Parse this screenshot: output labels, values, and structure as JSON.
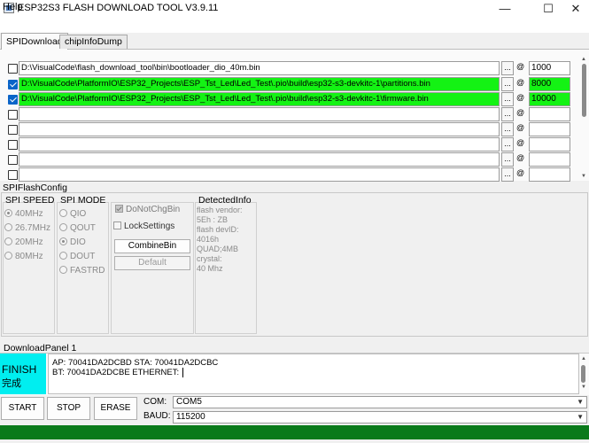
{
  "window": {
    "title": "ESP32S3 FLASH DOWNLOAD TOOL V3.9.11",
    "minimize": "—",
    "maximize": "☐",
    "close": "✕"
  },
  "menu": {
    "help": "Help"
  },
  "tabs": [
    {
      "label": "SPIDownload",
      "active": true
    },
    {
      "label": "chipInfoDump",
      "active": false
    }
  ],
  "files": [
    {
      "checked": false,
      "path": "D:\\VisualCode\\flash_download_tool\\bin\\bootloader_dio_40m.bin",
      "address": "1000",
      "highlight": false
    },
    {
      "checked": true,
      "path": "D:\\VisualCode\\PlatformIO\\ESP32_Projects\\ESP_Tst_Led\\Led_Test\\.pio\\build\\esp32-s3-devkitc-1\\partitions.bin",
      "address": "8000",
      "highlight": true
    },
    {
      "checked": true,
      "path": "D:\\VisualCode\\PlatformIO\\ESP32_Projects\\ESP_Tst_Led\\Led_Test\\.pio\\build\\esp32-s3-devkitc-1\\firmware.bin",
      "address": "10000",
      "highlight": true
    },
    {
      "checked": false,
      "path": "",
      "address": "",
      "highlight": false
    },
    {
      "checked": false,
      "path": "",
      "address": "",
      "highlight": false
    },
    {
      "checked": false,
      "path": "",
      "address": "",
      "highlight": false
    },
    {
      "checked": false,
      "path": "",
      "address": "",
      "highlight": false
    },
    {
      "checked": false,
      "path": "",
      "address": "",
      "highlight": false
    }
  ],
  "browse_label": "...",
  "at_label": "@",
  "spi_flash_config": {
    "label": "SPIFlashConfig",
    "spi_speed": {
      "title": "SPI SPEED",
      "options": [
        "40MHz",
        "26.7MHz",
        "20MHz",
        "80MHz"
      ],
      "selected": "40MHz"
    },
    "spi_mode": {
      "title": "SPI MODE",
      "options": [
        "QIO",
        "QOUT",
        "DIO",
        "DOUT",
        "FASTRD"
      ],
      "selected": "DIO"
    },
    "do_not_chg_bin": {
      "label": "DoNotChgBin",
      "checked": true
    },
    "lock_settings": {
      "label": "LockSettings",
      "checked": false
    },
    "combine_bin": "CombineBin",
    "default": "Default",
    "detected_info": {
      "title": "DetectedInfo",
      "lines": [
        "flash vendor:",
        "5Eh : ZB",
        "flash devID:",
        "4016h",
        "QUAD;4MB",
        "crystal:",
        "40 Mhz"
      ]
    }
  },
  "download_panel": {
    "label": "DownloadPanel 1",
    "status_en": "FINISH",
    "status_cn": "完成",
    "log_line1": "AP:  70041DA2DCBD  STA:  70041DA2DCBC",
    "log_line2": "BT:  70041DA2DCBE  ETHERNET: "
  },
  "controls": {
    "start": "START",
    "stop": "STOP",
    "erase": "ERASE",
    "com_label": "COM:",
    "com_value": "COM5",
    "baud_label": "BAUD:",
    "baud_value": "115200"
  },
  "progress": {
    "fraction": 1.0,
    "color": "#0a7a1a"
  },
  "colors": {
    "finish_bg": "#00eef0",
    "path_highlight": "#14f214"
  }
}
